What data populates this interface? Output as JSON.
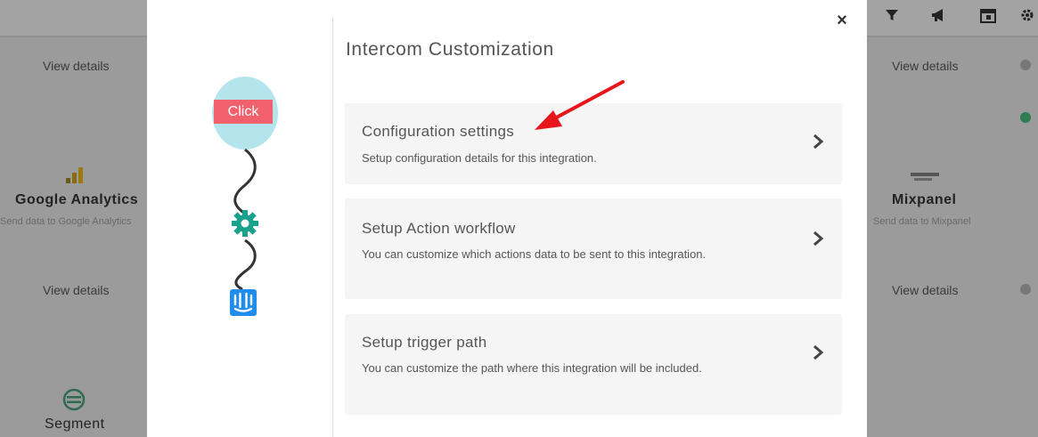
{
  "background": {
    "cards": [
      {
        "title": "Google Analytics",
        "subtitle": "Send data to Google Analytics"
      },
      {
        "title": "Mixpanel",
        "subtitle": "Send data to Mixpanel"
      },
      {
        "title": "Segment",
        "subtitle": ""
      }
    ],
    "view_details": [
      "View details",
      "View details",
      "View details",
      "View details"
    ]
  },
  "modal": {
    "title": "Intercom Customization",
    "close_symbol": "×",
    "illustration": {
      "click_label": "Click"
    },
    "options": [
      {
        "title": "Configuration settings",
        "description": "Setup configuration details for this integration."
      },
      {
        "title": "Setup Action workflow",
        "description": "You can customize which actions data to be sent to this integration."
      },
      {
        "title": "Setup trigger path",
        "description": "You can customize the path where this integration will be included."
      }
    ]
  },
  "colors": {
    "balloon": "#b4e5ec",
    "click_badge": "#f0616d",
    "gear": "#1aa08b",
    "intercom_logo": "#1f8ded",
    "arrow": "#e8161b"
  }
}
